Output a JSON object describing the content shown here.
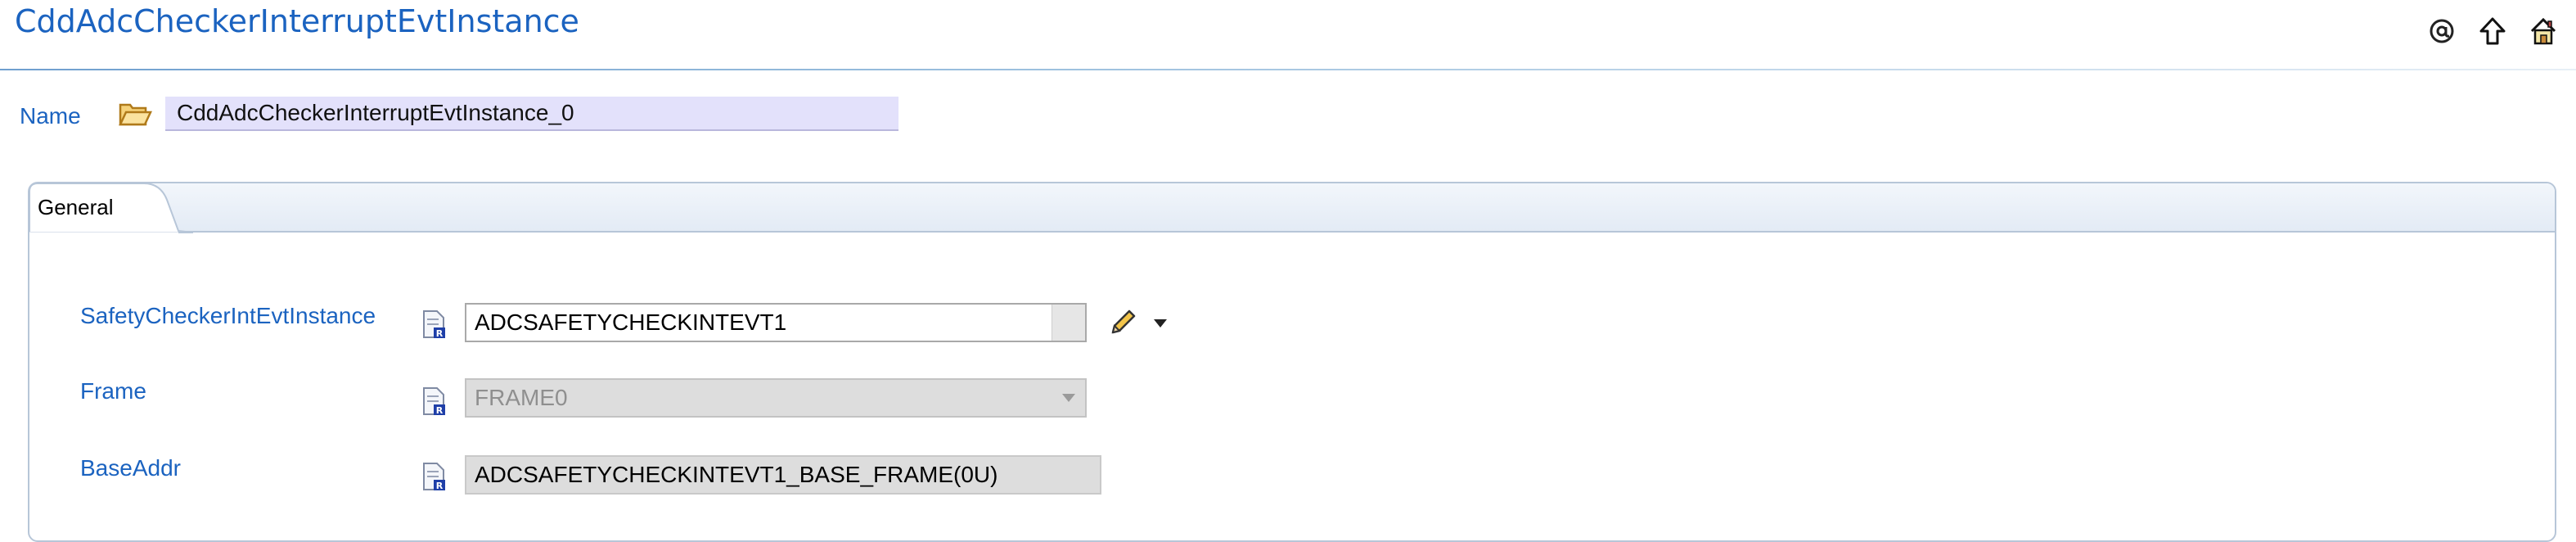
{
  "header": {
    "title": "CddAdcCheckerInterruptEvtInstance",
    "icons": [
      "at-icon",
      "up-arrow-icon",
      "home-icon"
    ]
  },
  "name_field": {
    "label": "Name",
    "value": "CddAdcCheckerInterruptEvtInstance_0"
  },
  "tabs": [
    {
      "label": "General",
      "active": true
    }
  ],
  "fields": {
    "safety": {
      "label": "SafetyCheckerIntEvtInstance",
      "value": "ADCSAFETYCHECKINTEVT1"
    },
    "frame": {
      "label": "Frame",
      "value": "FRAME0"
    },
    "baseaddr": {
      "label": "BaseAddr",
      "value": "ADCSAFETYCHECKINTEVT1_BASE_FRAME(0U)"
    }
  },
  "colors": {
    "link_blue": "#1b63c0",
    "name_field_bg": "#e3e1fb",
    "disabled_bg": "#dddddd"
  }
}
